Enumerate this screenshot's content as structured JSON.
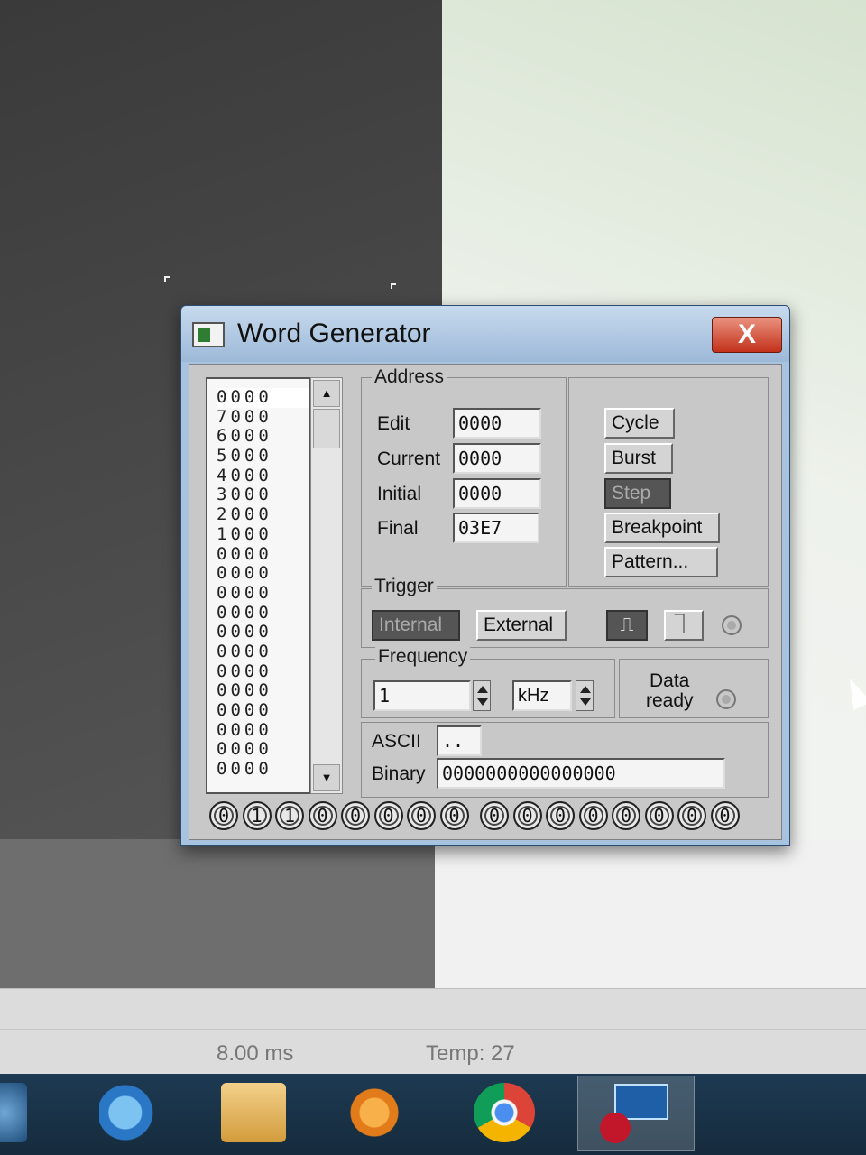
{
  "window": {
    "title": "Word Generator",
    "close_label": "X"
  },
  "words": [
    "0000",
    "7000",
    "6000",
    "5000",
    "4000",
    "3000",
    "2000",
    "1000",
    "0000",
    "0000",
    "0000",
    "0000",
    "0000",
    "0000",
    "0000",
    "0000",
    "0000",
    "0000",
    "0000",
    "0000"
  ],
  "address": {
    "group_label": "Address",
    "edit_label": "Edit",
    "edit_value": "0000",
    "current_label": "Current",
    "current_value": "0000",
    "initial_label": "Initial",
    "initial_value": "0000",
    "final_label": "Final",
    "final_value": "03E7"
  },
  "controls": {
    "cycle": "Cycle",
    "burst": "Burst",
    "step": "Step",
    "breakpoint": "Breakpoint",
    "pattern": "Pattern..."
  },
  "trigger": {
    "group_label": "Trigger",
    "internal": "Internal",
    "external": "External"
  },
  "frequency": {
    "group_label": "Frequency",
    "value": "1",
    "unit": "kHz",
    "data_ready_label_1": "Data",
    "data_ready_label_2": "ready"
  },
  "ascii": {
    "label": "ASCII",
    "value": ".."
  },
  "binary": {
    "label": "Binary",
    "value": "0000000000000000"
  },
  "bits": [
    "0",
    "1",
    "1",
    "0",
    "0",
    "0",
    "0",
    "0",
    "0",
    "0",
    "0",
    "0",
    "0",
    "0",
    "0",
    "0"
  ],
  "status": {
    "time": "8.00 ms",
    "temp": "Temp:  27"
  },
  "taskbar": {
    "icons": [
      "start-orb-icon",
      "internet-explorer-icon",
      "file-explorer-icon",
      "media-player-icon",
      "chrome-icon",
      "multisim-icon"
    ]
  }
}
